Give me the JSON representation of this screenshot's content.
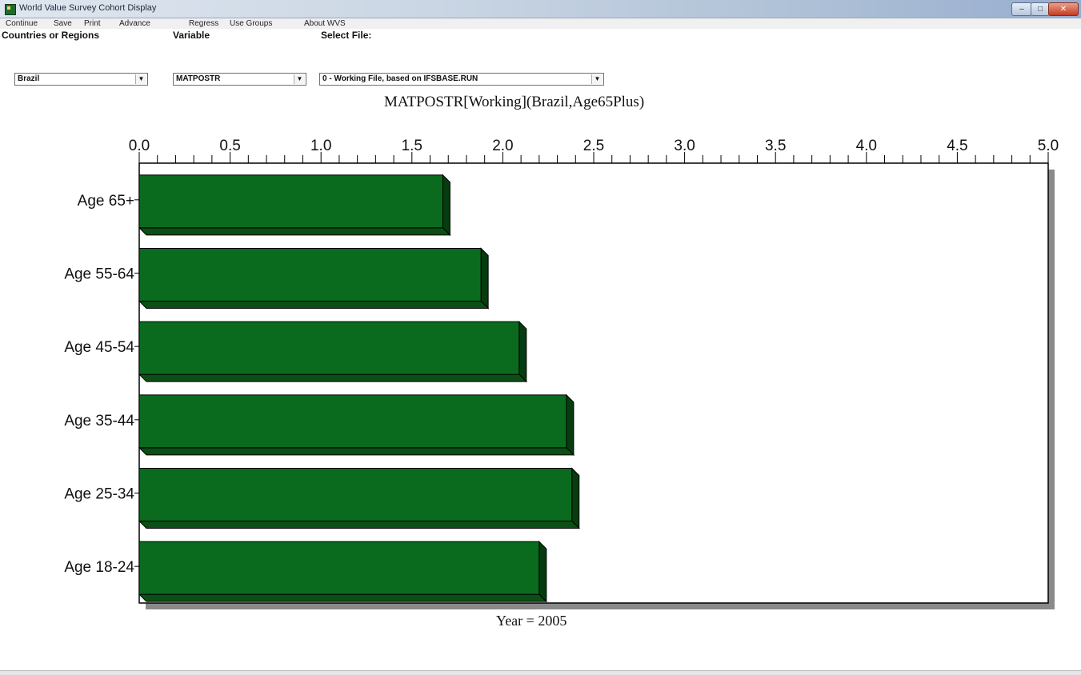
{
  "window": {
    "title": "World Value Survey Cohort Display",
    "min_label": "–",
    "max_label": "□",
    "close_label": "✕"
  },
  "menu": {
    "items": [
      "Continue",
      "Save",
      "Print",
      "Advance",
      "Regress",
      "Use Groups",
      "About WVS"
    ]
  },
  "toolbar": {
    "countries_label": "Countries or Regions",
    "variable_label": "Variable",
    "file_label": "Select File:",
    "country_value": "Brazil",
    "variable_value": "MATPOSTR",
    "file_value": "0 - Working File, based on IFSBASE.RUN"
  },
  "chart_data": {
    "type": "bar",
    "orientation": "horizontal",
    "title": "MATPOSTR[Working](Brazil,Age65Plus)",
    "footer": "Year =  2005",
    "categories": [
      "Age 65+",
      "Age 55-64",
      "Age 45-54",
      "Age 35-44",
      "Age 25-34",
      "Age 18-24"
    ],
    "values": [
      1.67,
      1.88,
      2.09,
      2.35,
      2.38,
      2.2
    ],
    "xlim": [
      0,
      5
    ],
    "x_ticks": [
      "0.0",
      "0.5",
      "1.0",
      "1.5",
      "2.0",
      "2.5",
      "3.0",
      "3.5",
      "4.0",
      "4.5",
      "5.0"
    ],
    "axis_position": "top",
    "bar_color": "#0a6b1e",
    "grid": false,
    "legend": "none"
  }
}
